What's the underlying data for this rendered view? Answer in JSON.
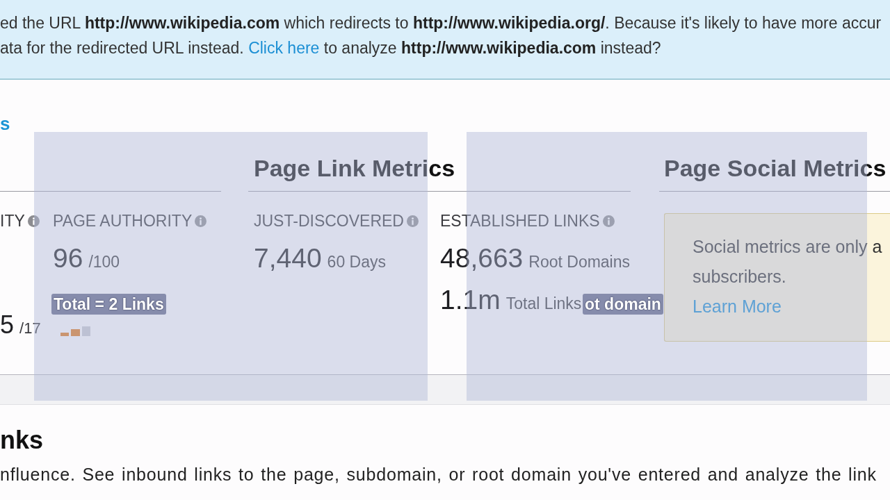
{
  "banner": {
    "lines": [
      {
        "text": "ed the URL **http://www.wikipedia.com** which redirects to **http://www.wikipedia.org/**. Because it's likely to have more accur"
      },
      {
        "text": "ata for the redirected URL instead.",
        "link": "Click here",
        "after": "to analyze **http://www.wikipedia.com** instead?"
      }
    ]
  },
  "nav_fragment": "s",
  "headings": [
    {
      "title": "Page Link Metrics"
    },
    {
      "title": "Page Social Metrics"
    }
  ],
  "metrics": [
    {
      "label": "ITY",
      "info": true,
      "values": [
        {
          "kind": "score",
          "number": "5",
          "unit": "/17"
        }
      ]
    },
    {
      "label": "PAGE AUTHORITY",
      "info": true,
      "values": [
        {
          "kind": "main",
          "number": "96",
          "unit": "/100"
        },
        {
          "kind": "bars"
        }
      ]
    },
    {
      "label": "JUST-DISCOVERED",
      "info": true,
      "values": [
        {
          "kind": "main",
          "number": "7,440",
          "unit": "60 Days"
        }
      ]
    },
    {
      "label": "ESTABLISHED LINKS",
      "info": true,
      "values": [
        {
          "kind": "main",
          "number": "48,663",
          "unit": "Root Domains"
        },
        {
          "kind": "extra",
          "number": "1.1m",
          "unit": "Total Links"
        }
      ]
    }
  ],
  "social_notice": {
    "lines": [
      "Social metrics are only a",
      "subscribers."
    ],
    "link": "Learn More"
  },
  "overlays": [
    {
      "lines": [
        "Total = 2 Links"
      ]
    },
    {
      "lines": [
        "ot domain"
      ]
    }
  ],
  "section": {
    "title": "nks",
    "description": "nfluence. See inbound links to the page, subdomain, or root domain you've entered and analyze the link"
  }
}
